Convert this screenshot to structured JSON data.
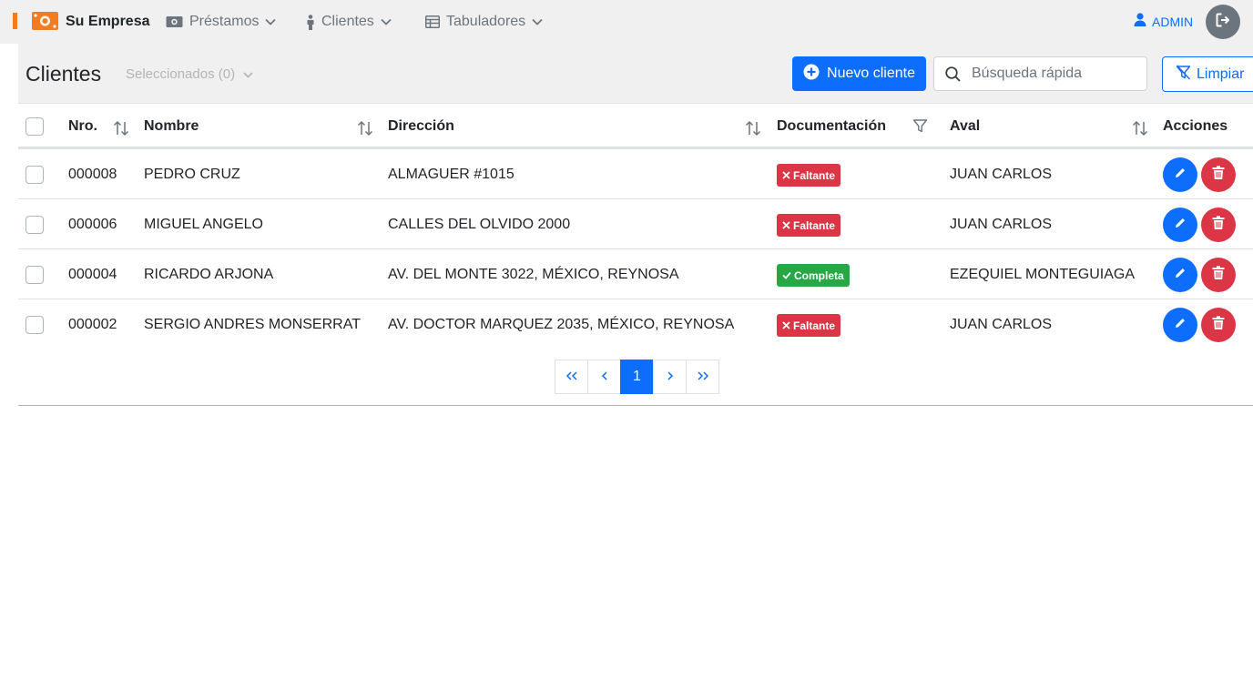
{
  "colors": {
    "primary": "#0d6efd",
    "danger": "#dc3545",
    "success": "#28a745",
    "brand_orange": "#f47c20"
  },
  "navbar": {
    "brand": "Su Empresa",
    "items": [
      {
        "label": "Préstamos",
        "icon": "money-icon"
      },
      {
        "label": "Clientes",
        "icon": "person-icon"
      },
      {
        "label": "Tabuladores",
        "icon": "table-icon"
      }
    ],
    "user": "ADMIN"
  },
  "header": {
    "title": "Clientes",
    "selected": "Seleccionados (0)",
    "new_button": "Nuevo cliente",
    "search_placeholder": "Búsqueda rápida",
    "clear_button": "Limpiar"
  },
  "table": {
    "columns": [
      "Nro.",
      "Nombre",
      "Dirección",
      "Documentación",
      "Aval",
      "Acciones"
    ],
    "rows": [
      {
        "nro": "000008",
        "nombre": "PEDRO CRUZ",
        "direccion": "ALMAGUER #1015",
        "doc": "Faltante",
        "doc_ok": false,
        "aval": "JUAN CARLOS"
      },
      {
        "nro": "000006",
        "nombre": "MIGUEL ANGELO",
        "direccion": "CALLES DEL OLVIDO 2000",
        "doc": "Faltante",
        "doc_ok": false,
        "aval": "JUAN CARLOS"
      },
      {
        "nro": "000004",
        "nombre": "RICARDO ARJONA",
        "direccion": "AV. DEL MONTE 3022, MÉXICO, REYNOSA",
        "doc": "Completa",
        "doc_ok": true,
        "aval": "EZEQUIEL MONTEGUIAGA"
      },
      {
        "nro": "000002",
        "nombre": "SERGIO ANDRES MONSERRAT",
        "direccion": "AV. DOCTOR MARQUEZ 2035, MÉXICO, REYNOSA",
        "doc": "Faltante",
        "doc_ok": false,
        "aval": "JUAN CARLOS"
      }
    ]
  },
  "pagination": {
    "current": "1"
  }
}
